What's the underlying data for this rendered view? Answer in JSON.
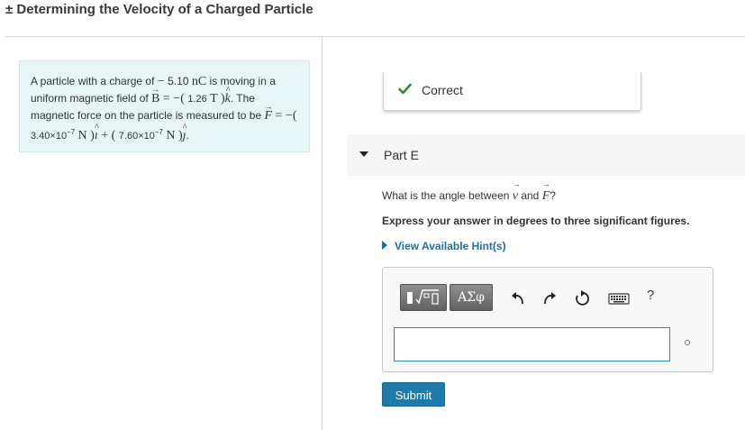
{
  "header": {
    "symbol": "±",
    "title": "Determining the Velocity of a Charged Particle"
  },
  "intro": {
    "t1": "A particle with a charge of ",
    "charge_sign": "− ",
    "charge_value": "5.10",
    "charge_unit": "nC",
    "t2": " is moving in a uniform magnetic field of ",
    "b_symbol": "B",
    "b_eq": " = −( ",
    "b_value": "1.26",
    "b_unit": "T",
    "b_close": " )",
    "k_hat": "k",
    "t3": ". The magnetic force on the particle is measured to be ",
    "f_symbol": "F",
    "f_eq": " = −( ",
    "f1_mantissa": "3.40×10",
    "f1_exp": "−7",
    "f_unit": "N",
    "f_mid": " )",
    "i_hat": "ı",
    "plus": " + ( ",
    "f2_mantissa": "7.60×10",
    "f2_exp": "−7",
    "j_hat": "ȷ",
    "period": "."
  },
  "status": {
    "label": "Correct",
    "color": "#2e8b3a"
  },
  "part": {
    "label": "Part E"
  },
  "question": {
    "t1": "What is the angle between ",
    "v_symbol": "v",
    "t2": " and ",
    "f_symbol": "F",
    "t3": "?"
  },
  "instruction": "Express your answer in degrees to three significant figures.",
  "hint": {
    "label": "View Available Hint(s)"
  },
  "editor": {
    "greek_label": "ΑΣφ",
    "help_label": "?",
    "input_value": "",
    "icons": [
      "template-icon",
      "undo-icon",
      "redo-icon",
      "reset-icon",
      "keyboard-icon"
    ]
  },
  "submit": {
    "label": "Submit",
    "color": "#1d7bab"
  }
}
